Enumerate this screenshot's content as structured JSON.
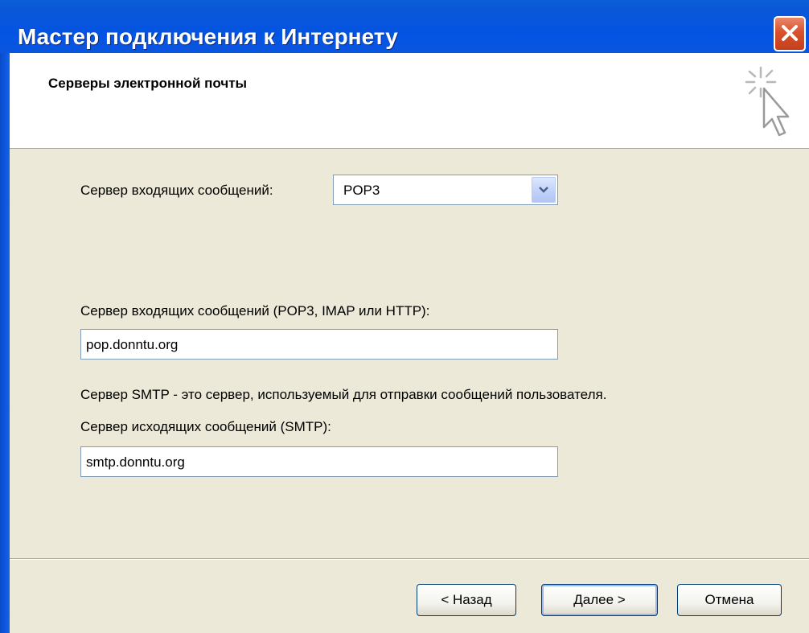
{
  "window": {
    "title": "Мастер подключения к Интернету"
  },
  "header": {
    "title": "Серверы электронной почты"
  },
  "form": {
    "incoming_type_label": "Сервер входящих сообщений:",
    "incoming_type_value": "POP3",
    "incoming_server_label": "Сервер входящих сообщений (POP3, IMAP или HTTP):",
    "incoming_server_value": "pop.donntu.org",
    "smtp_info": "Сервер SMTP - это сервер, используемый для отправки сообщений  пользователя.",
    "outgoing_server_label": "Сервер исходящих сообщений (SMTP):",
    "outgoing_server_value": "smtp.donntu.org"
  },
  "buttons": {
    "back": "< Назад",
    "next": "Далее >",
    "cancel": "Отмена"
  },
  "icons": {
    "close": "close-icon",
    "wizard": "cursor-sparkle-icon",
    "dropdown": "chevron-down-icon"
  },
  "colors": {
    "titlebar": "#0454e3",
    "dialog_bg": "#ece9d8",
    "close_button": "#d8502c"
  }
}
